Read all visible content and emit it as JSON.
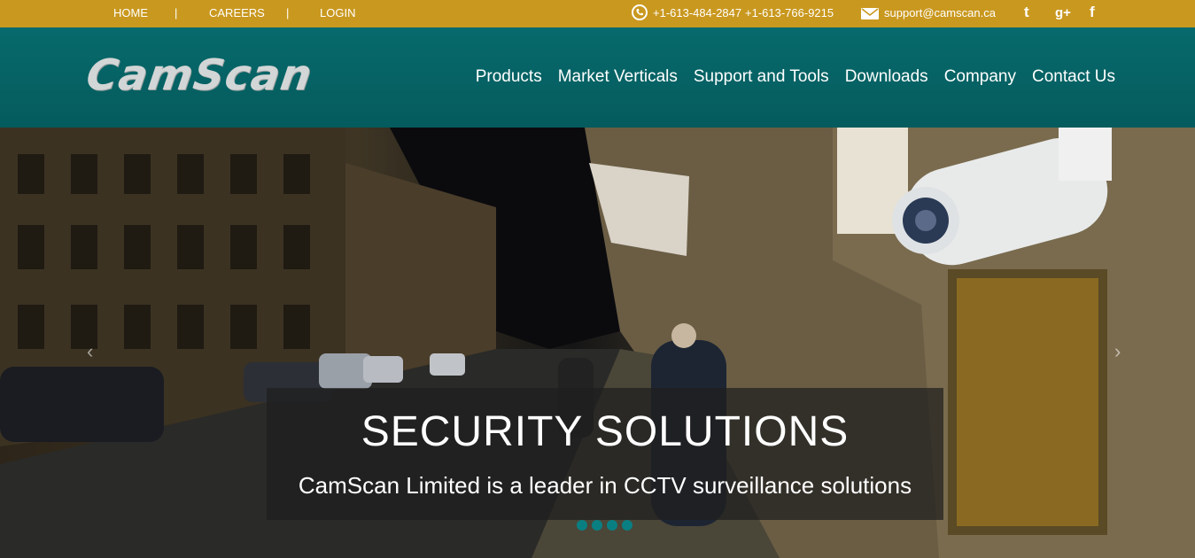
{
  "topbar": {
    "links": [
      "HOME",
      "CAREERS",
      "LOGIN"
    ],
    "separator": "|",
    "phone1": "+1-613-484-2847",
    "phone2": "+1-613-766-9215",
    "email": "support@camscan.ca",
    "social": {
      "twitter": "t",
      "google": "g+",
      "facebook": "f"
    }
  },
  "header": {
    "logo": "CamScan",
    "nav": [
      "Products",
      "Market Verticals",
      "Support and Tools",
      "Downloads",
      "Company",
      "Contact Us"
    ]
  },
  "hero": {
    "title": "SECURITY SOLUTIONS",
    "subtitle": "CamScan Limited is a leader in CCTV surveillance solutions",
    "prev_arrow": "‹",
    "next_arrow": "›",
    "slide_count": 4
  },
  "colors": {
    "topbar": "#c9981f",
    "header": "#076a6c",
    "dot": "#0a7f82"
  },
  "icons": [
    "phone-icon",
    "mail-icon",
    "twitter-icon",
    "google-plus-icon",
    "facebook-icon",
    "chevron-left-icon",
    "chevron-right-icon"
  ]
}
